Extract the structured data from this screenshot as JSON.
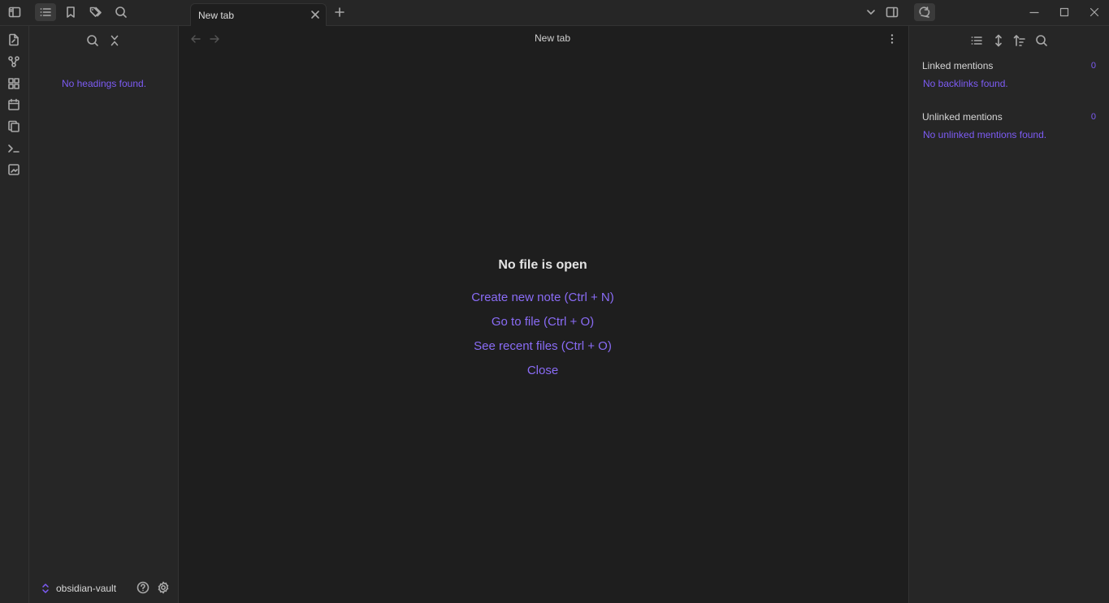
{
  "titlebar": {
    "tab_title": "New tab"
  },
  "left_sidebar": {
    "empty_message": "No headings found.",
    "vault_name": "obsidian-vault"
  },
  "main": {
    "title": "New tab",
    "empty_state": {
      "heading": "No file is open",
      "actions": [
        "Create new note (Ctrl + N)",
        "Go to file (Ctrl + O)",
        "See recent files (Ctrl + O)",
        "Close"
      ]
    }
  },
  "right_sidebar": {
    "linked": {
      "title": "Linked mentions",
      "count": "0",
      "empty": "No backlinks found."
    },
    "unlinked": {
      "title": "Unlinked mentions",
      "count": "0",
      "empty": "No unlinked mentions found."
    }
  },
  "colors": {
    "accent": "#7d5cf5",
    "background": "#1e1e1e",
    "panel": "#262626"
  },
  "icons": {
    "titlebar": [
      "sidebar-toggle-icon",
      "outline-icon",
      "bookmark-icon",
      "tags-icon",
      "search-icon",
      "close-icon",
      "plus-icon",
      "chevron-down-icon",
      "split-panel-icon",
      "sync-icon",
      "minimize-icon",
      "maximize-icon",
      "window-close-icon"
    ],
    "ribbon": [
      "new-note-icon",
      "graph-icon",
      "canvas-icon",
      "daily-note-icon",
      "templates-icon",
      "command-palette-icon",
      "slides-icon"
    ]
  }
}
